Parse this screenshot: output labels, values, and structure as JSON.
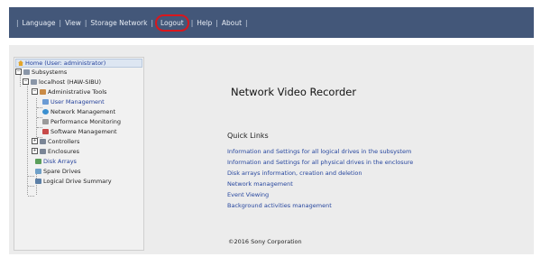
{
  "menu": {
    "items": [
      "Language",
      "View",
      "Storage Network",
      "Logout",
      "Help",
      "About"
    ]
  },
  "tree": {
    "home": "Home (User: administrator)",
    "subsystems": "Subsystems",
    "localhost": "localhost (HAW-SIBU)",
    "admin_tools": "Administrative Tools",
    "user_mgmt": "User Management",
    "network_mgmt": "Network Management",
    "perf_monitoring": "Performance Monitoring",
    "software_mgmt": "Software Management",
    "controllers": "Controllers",
    "enclosures": "Enclosures",
    "disk_arrays": "Disk Arrays",
    "spare_drives": "Spare Drives",
    "logical_summary": "Logical Drive Summary"
  },
  "main": {
    "title": "Network Video Recorder",
    "quick_links_title": "Quick Links",
    "quick_links": [
      "Information and Settings for all logical drives in the subsystem",
      "Information and Settings for all physical drives in the enclosure",
      "Disk arrays information, creation and deletion",
      "Network management",
      "Event Viewing",
      "Background activities management"
    ],
    "copyright": "©2016 Sony Corporation"
  },
  "colors": {
    "topbar": "#435779",
    "link": "#26469e",
    "highlight": "#d9171d"
  }
}
